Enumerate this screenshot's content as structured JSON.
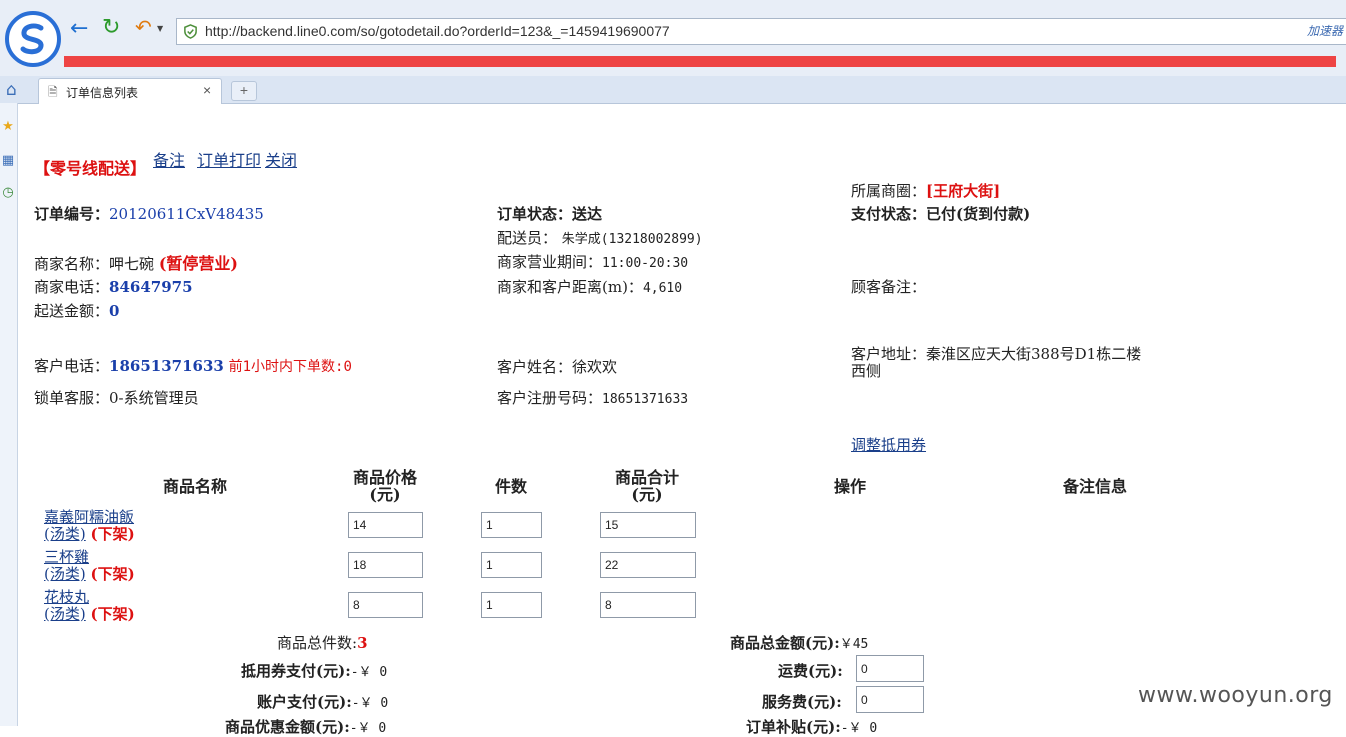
{
  "browser": {
    "url": "http://backend.line0.com/so/gotodetail.do?orderId=123&_=1459419690077",
    "accel_label": "加速器",
    "tab_title": "订单信息列表",
    "tab_close": "×",
    "new_tab": "+"
  },
  "header": {
    "brand": "【零号线配送】",
    "links": [
      "备注",
      "订单打印",
      "关闭"
    ]
  },
  "order": {
    "mall_label": "所属商圈：",
    "mall_value": "[王府大街]",
    "no_label": "订单编号：",
    "no_value": "20120611CxV48435",
    "status_label": "订单状态：",
    "status_value": "送达",
    "pay_label": "支付状态：",
    "pay_value": "已付(货到付款)",
    "courier_label": "配送员：",
    "courier_value": "朱学成(13218002899)",
    "merchant_label": "商家名称：",
    "merchant_value": "呷七碗",
    "merchant_state": "(暂停营业)",
    "hours_label": "商家营业期间：",
    "hours_value": "11:00-20:30",
    "phone_label": "商家电话：",
    "phone_value": "84647975",
    "distance_label": "商家和客户距离(m)：",
    "distance_value": "4,610",
    "remark_label": "顾客备注：",
    "min_label": "起送金额：",
    "min_value": "0",
    "cust_phone_label": "客户电话：",
    "cust_phone_value": "18651371633",
    "recent_orders": "前1小时内下单数:0",
    "cust_name_label": "客户姓名：",
    "cust_name_value": "徐欢欢",
    "addr_label": "客户地址：",
    "addr_line1": "秦淮区应天大街388号D1栋二楼",
    "addr_line2": "西侧",
    "lock_label": "锁单客服：",
    "lock_value": "0-系统管理员",
    "reg_label": "客户注册号码：",
    "reg_value": "18651371633",
    "coupon_link": "调整抵用券"
  },
  "table": {
    "headers": {
      "name": "商品名称",
      "price_l1": "商品价格",
      "price_l2": "(元)",
      "qty": "件数",
      "total_l1": "商品合计",
      "total_l2": "(元)",
      "action": "操作",
      "note": "备注信息"
    },
    "rows": [
      {
        "name": "嘉義阿糯油飯",
        "cat": "(汤类)",
        "state": "(下架)",
        "price": "14",
        "qty": "1",
        "total": "15"
      },
      {
        "name": "三杯雞",
        "cat": "(汤类)",
        "state": "(下架)",
        "price": "18",
        "qty": "1",
        "total": "22"
      },
      {
        "name": "花枝丸",
        "cat": "(汤类)",
        "state": "(下架)",
        "price": "8",
        "qty": "1",
        "total": "8"
      }
    ]
  },
  "summary": {
    "count_label": "商品总件数:",
    "count_value": "3",
    "amount_label": "商品总金额(元):",
    "amount_value": "￥45",
    "coupon_label": "抵用券支付(元):",
    "coupon_value": "-￥ 0",
    "freight_label": "运费(元):",
    "freight_value": "0",
    "account_label": "账户支付(元):",
    "account_value": "-￥ 0",
    "service_label": "服务费(元):",
    "service_value": "0",
    "discount_label": "商品优惠金额(元):",
    "discount_value": "-￥ 0",
    "subsidy_label": "订单补贴(元):",
    "subsidy_value": "-￥ 0"
  },
  "watermark": "www.wooyun.org",
  "colors": {
    "brand_red": "#d11111",
    "link_blue": "#1a3f8a",
    "value_blue": "#1a3faa",
    "redacted_bar": "#ee4444"
  }
}
